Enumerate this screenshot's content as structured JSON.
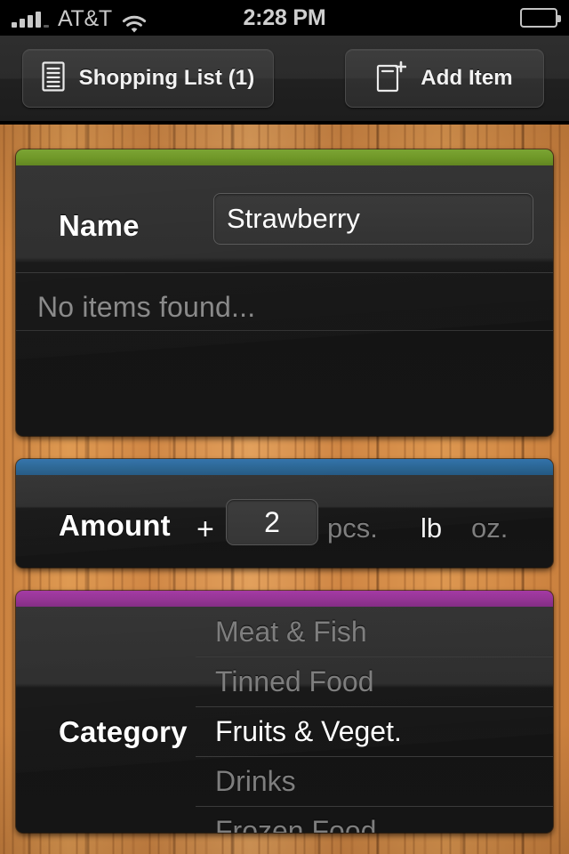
{
  "statusbar": {
    "carrier": "AT&T",
    "time": "2:28 PM",
    "signal_icon": "signal-bars-icon",
    "wifi_icon": "wifi-icon",
    "battery_icon": "battery-icon",
    "signal_bars": 4,
    "battery_level_pct": 92
  },
  "toolbar": {
    "shopping_list_label": "Shopping List (1)",
    "shopping_list_icon": "list-document-icon",
    "add_item_label": "Add Item",
    "add_item_icon": "document-plus-icon"
  },
  "name_section": {
    "label": "Name",
    "accent_color": "#69931f",
    "input_value": "Strawberry",
    "input_placeholder": "",
    "empty_results": "No items found..."
  },
  "amount_section": {
    "label": "Amount",
    "accent_color": "#23608f",
    "plus_label": "+",
    "value": "2",
    "units": [
      {
        "label": "pcs.",
        "selected": false
      },
      {
        "label": "lb",
        "selected": true
      },
      {
        "label": "oz.",
        "selected": false
      }
    ]
  },
  "category_section": {
    "label": "Category",
    "accent_color": "#902d90",
    "items": [
      {
        "label": "Meat & Fish",
        "selected": false
      },
      {
        "label": "Tinned Food",
        "selected": false
      },
      {
        "label": "Fruits & Veget.",
        "selected": true
      },
      {
        "label": "Drinks",
        "selected": false
      },
      {
        "label": "Frozen Food",
        "selected": false
      }
    ]
  },
  "background": {
    "texture": "wood",
    "base_color": "#d08745"
  }
}
